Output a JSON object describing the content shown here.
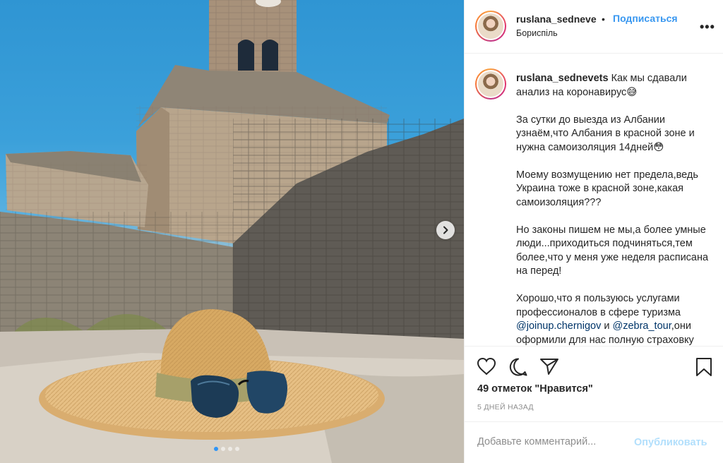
{
  "post": {
    "username": "ruslana_sedneve",
    "separator": "•",
    "follow_label": "Подписаться",
    "location": "Бориспіль",
    "more_label": "•••"
  },
  "caption": {
    "username": "ruslana_sednevets",
    "text_1": " Как мы сдавали анализ на коронавирус😅\n\nЗа сутки до выезда из Албании узнаём,что Албания в красной зоне и нужна самоизоляция 14дней😳\n\nМоему возмущению нет предела,ведь Украина тоже в красной зоне,какая самоизоляция???\n\nНо законы пишем не мы,а более умные люди...приходиться подчиняться,тем более,что у меня уже неделя расписана на перед!\n\nХорошо,что я пользуюсь услугами профессионалов в сфере туризма ",
    "mention_1": "@joinup.chernigov",
    "and": " и ",
    "mention_2": "@zebra_tour",
    "text_2": ",они оформили для нас полную страховку"
  },
  "actions": {
    "likes": "49 отметок \"Нравится\"",
    "date": "5 ДНЕЙ НАЗАД"
  },
  "comment": {
    "placeholder": "Добавьте комментарий...",
    "publish_label": "Опубликовать"
  },
  "carousel": {
    "total": 4,
    "active_index": 0
  },
  "colors": {
    "link": "#3897f0",
    "mention": "#003569",
    "publish_disabled": "#b2dffc",
    "active_dot": "#2f95f6"
  },
  "icons": {
    "like": "heart-icon",
    "comment": "comment-icon",
    "share": "paper-plane-icon",
    "save": "bookmark-icon",
    "next": "chevron-right-icon"
  }
}
